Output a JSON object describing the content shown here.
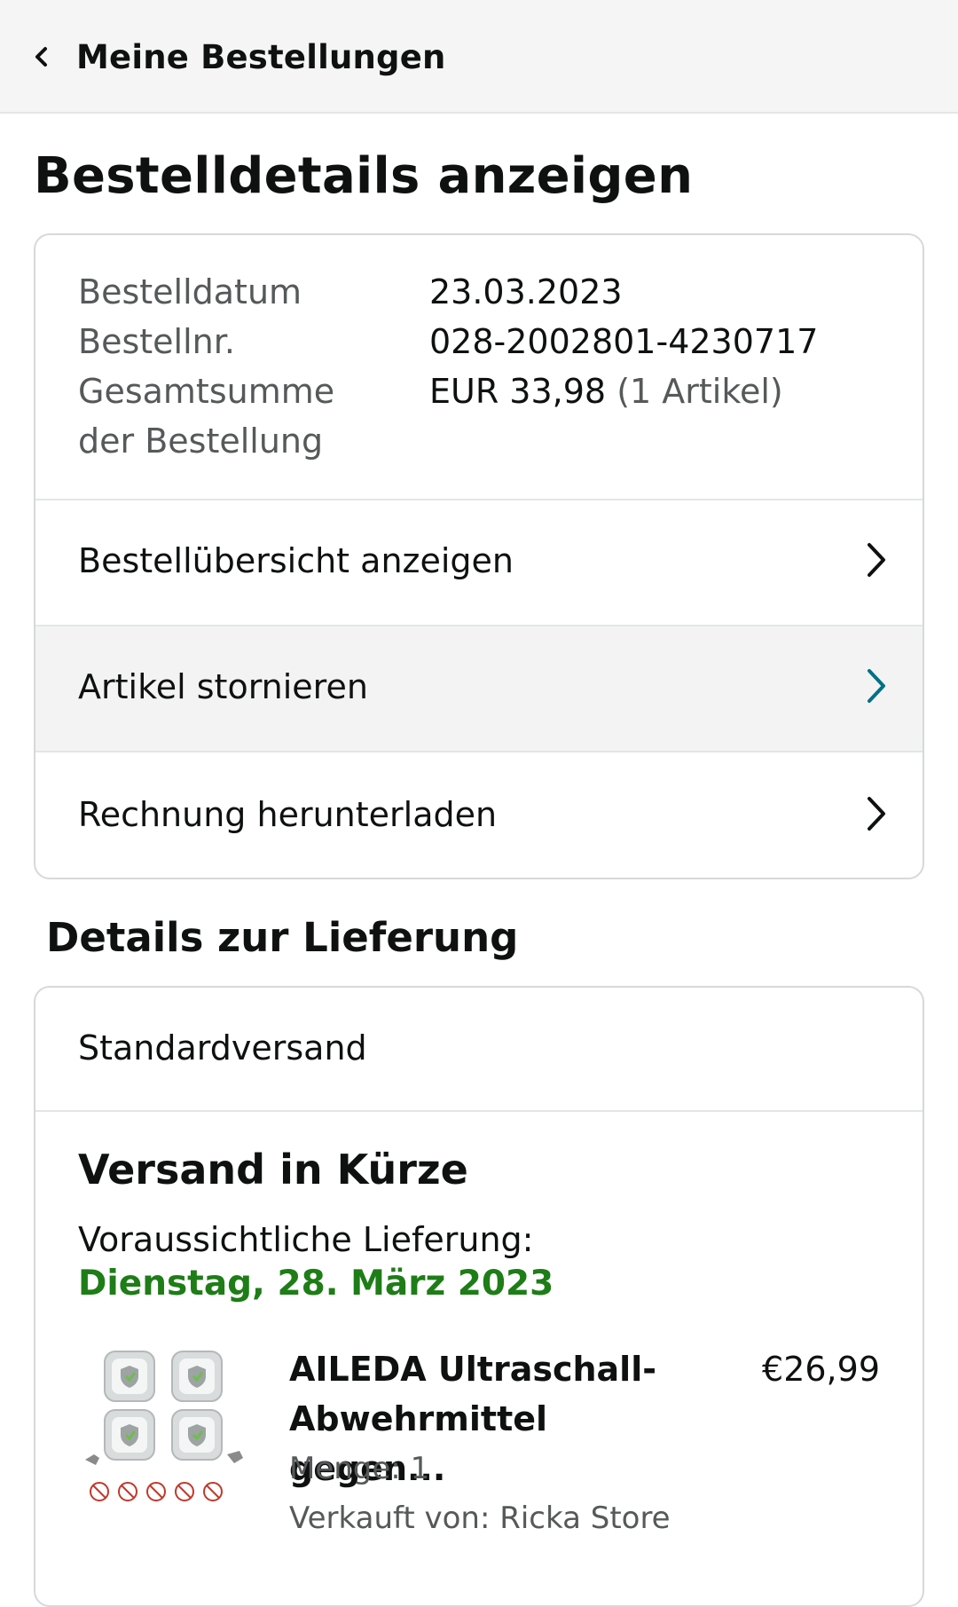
{
  "nav": {
    "back_label": "Meine Bestellungen"
  },
  "page": {
    "title": "Bestelldetails anzeigen"
  },
  "order_info": {
    "rows": [
      {
        "label": "Bestelldatum",
        "value": "23.03.2023"
      },
      {
        "label": "Bestellnr.",
        "value": "028-2002801-4230717"
      },
      {
        "label": "Gesamtsumme der Bestellung",
        "value": "EUR 33,98",
        "value_suffix": "(1 Artikel)"
      }
    ]
  },
  "actions": [
    {
      "label": "Bestellübersicht anzeigen"
    },
    {
      "label": "Artikel stornieren"
    },
    {
      "label": "Rechnung herunterladen"
    }
  ],
  "delivery": {
    "section_title": "Details zur Lieferung",
    "shipping_method": "Standardversand",
    "status": "Versand in Kürze",
    "eta_label": "Voraussichtliche Lieferung:",
    "eta_date": "Dienstag, 28. März 2023",
    "eta_color": "#1e7d17"
  },
  "product": {
    "title": "AILEDA Ultraschall-Abwehrmittel gegen...",
    "price": "€26,99",
    "quantity": "Menge: 1",
    "seller": "Verkauft von: Ricka Store",
    "image_icon": "ultrasonic-repeller-product-image"
  },
  "colors": {
    "accent_chevron": "#007185",
    "chevron": "#0f1111"
  }
}
